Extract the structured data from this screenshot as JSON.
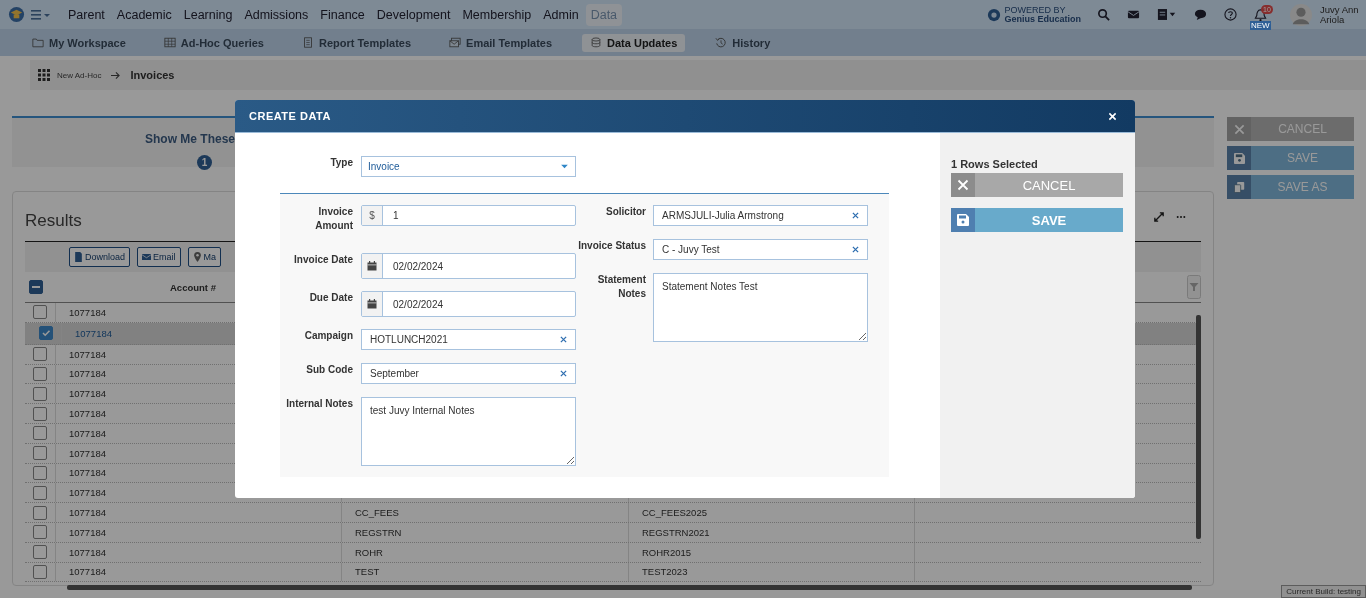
{
  "top_nav": {
    "menu_items": [
      {
        "label": "Parent",
        "selected": false
      },
      {
        "label": "Academic",
        "selected": false
      },
      {
        "label": "Learning",
        "selected": false
      },
      {
        "label": "Admissions",
        "selected": false
      },
      {
        "label": "Finance",
        "selected": false
      },
      {
        "label": "Development",
        "selected": false
      },
      {
        "label": "Membership",
        "selected": false
      },
      {
        "label": "Admin",
        "selected": false
      },
      {
        "label": "Data",
        "selected": true
      }
    ],
    "powered_by": [
      "POWERED BY",
      "Genius Education"
    ],
    "notification_count": "10",
    "notification_tag": "NEW",
    "user_name": [
      "Juvy Ann",
      "Ariola"
    ]
  },
  "sub_nav": {
    "tabs": [
      {
        "label": "My Workspace",
        "kind": "folder",
        "selected": false
      },
      {
        "label": "Ad-Hoc Queries",
        "kind": "table",
        "selected": false
      },
      {
        "label": "Report Templates",
        "kind": "document",
        "selected": false
      },
      {
        "label": "Email Templates",
        "kind": "envelopes",
        "selected": false
      },
      {
        "label": "Data Updates",
        "kind": "database",
        "selected": true
      },
      {
        "label": "History",
        "kind": "history",
        "selected": false
      }
    ]
  },
  "breadcrumb": [
    "New Ad-Hoc",
    "Invoices"
  ],
  "step_panel": {
    "title": "Show Me These",
    "step": "1"
  },
  "results": {
    "title": "Results",
    "toolbar": [
      {
        "label": "Download",
        "kind": "file"
      },
      {
        "label": "Email",
        "kind": "envelope"
      },
      {
        "label": "Ma",
        "kind": "pin"
      }
    ],
    "select_all_indeterminate": true,
    "column_header": "Account #",
    "rows": [
      {
        "selected": false,
        "account": "1077184"
      },
      {
        "selected": true,
        "account": "1077184"
      },
      {
        "selected": false,
        "account": "1077184"
      },
      {
        "selected": false,
        "account": "1077184"
      },
      {
        "selected": false,
        "account": "1077184"
      },
      {
        "selected": false,
        "account": "1077184"
      },
      {
        "selected": false,
        "account": "1077184"
      },
      {
        "selected": false,
        "account": "1077184"
      },
      {
        "selected": false,
        "account": "1077184"
      },
      {
        "selected": false,
        "account": "1077184"
      },
      {
        "selected": false,
        "account": "1077184",
        "column_2": "CC_FEES",
        "column_3": "CC_FEES2025"
      },
      {
        "selected": false,
        "account": "1077184",
        "column_2": "REGSTRN",
        "column_3": "REGSTRN2021"
      },
      {
        "selected": false,
        "account": "1077184",
        "column_2": "ROHR",
        "column_3": "ROHR2015"
      },
      {
        "selected": false,
        "account": "1077184",
        "column_2": "TEST",
        "column_3": "TEST2023"
      }
    ]
  },
  "page_actions": [
    {
      "label": "CANCEL",
      "kind": "cancel"
    },
    {
      "label": "SAVE",
      "kind": "save"
    },
    {
      "label": "SAVE AS",
      "kind": "save_as"
    }
  ],
  "build_info": "Current Build: testing",
  "modal": {
    "title": "CREATE DATA",
    "type_field": {
      "label": "Type",
      "value": "Invoice"
    },
    "left_fields": [
      {
        "kind": "currency",
        "label": "Invoice Amount",
        "prefix": "$",
        "value": "1"
      },
      {
        "kind": "date",
        "label": "Invoice Date",
        "value": "02/02/2024"
      },
      {
        "kind": "date",
        "label": "Due Date",
        "value": "02/02/2024"
      },
      {
        "kind": "lookup",
        "label": "Campaign",
        "value": "HOTLUNCH2021"
      },
      {
        "kind": "lookup",
        "label": "Sub Code",
        "value": "September"
      },
      {
        "kind": "textarea",
        "label": "Internal Notes",
        "value": "test Juvy Internal Notes"
      }
    ],
    "right_fields": [
      {
        "kind": "lookup",
        "label": "Solicitor",
        "value": "ARMSJULI-Julia Armstrong"
      },
      {
        "kind": "lookup",
        "label": "Invoice Status",
        "value": "C - Juvy Test"
      },
      {
        "kind": "textarea",
        "label": "Statement Notes",
        "value": "Statement Notes Test"
      }
    ],
    "rows_selected": "1 Rows Selected",
    "actions": [
      {
        "label": "CANCEL",
        "kind": "cancel"
      },
      {
        "label": "SAVE",
        "kind": "save"
      }
    ]
  }
}
